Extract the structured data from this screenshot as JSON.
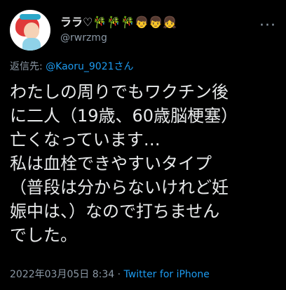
{
  "user": {
    "display_name": "ララ♡🎋🎋🎋👦👦👧",
    "handle": "@rwrzmg"
  },
  "reply": {
    "prefix": "返信先: ",
    "mention": "@Kaoru_9021さん"
  },
  "tweet": {
    "text": "わたしの周りでもワクチン後\nに二人（19歳、60歳脳梗塞）\n亡くなっています…\n私は血栓できやすいタイプ\n（普段は分からないけれど妊\n娠中は、）なので打ちません\nでした。"
  },
  "meta": {
    "datetime": "2022年03月05日 8:34",
    "separator": " · ",
    "source": "Twitter for iPhone"
  },
  "icons": {
    "more": "more-icon",
    "avatar": "avatar"
  },
  "colors": {
    "background": "#000000",
    "text": "#e7e9ea",
    "secondary": "#8b98a5",
    "accent": "#1d9bf0"
  }
}
